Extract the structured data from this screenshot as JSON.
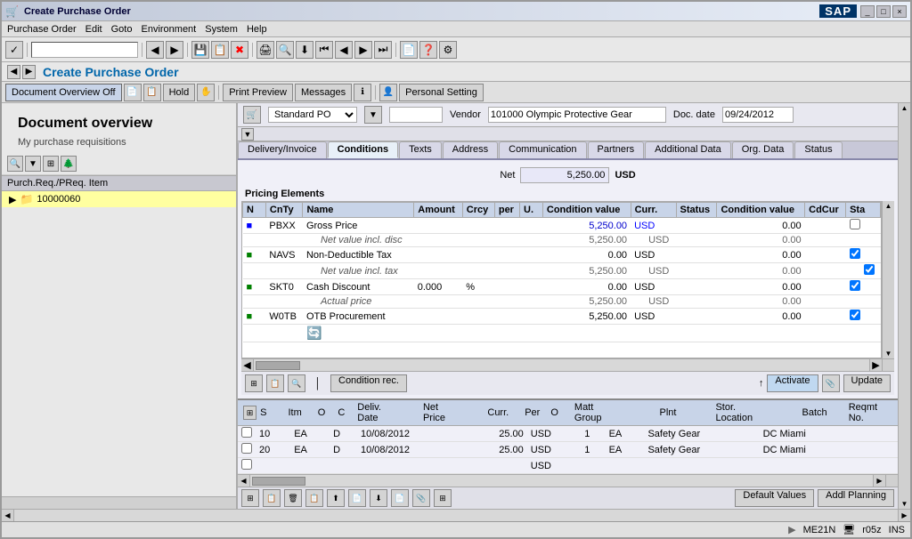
{
  "window": {
    "title": "Create Purchase Order",
    "controls": [
      "_",
      "□",
      "×"
    ]
  },
  "menu": {
    "items": [
      "Purchase Order",
      "Edit",
      "Goto",
      "Environment",
      "System",
      "Help"
    ]
  },
  "header": {
    "title": "Create Purchase Order",
    "logo": "SAP"
  },
  "action_toolbar": {
    "buttons": [
      {
        "label": "Document Overview Off",
        "active": true
      },
      {
        "label": "Hold"
      },
      {
        "label": "Print Preview"
      },
      {
        "label": "Messages"
      },
      {
        "label": "Personal Setting"
      }
    ]
  },
  "left_panel": {
    "title": "Document overview",
    "subtitle": "My purchase requisitions",
    "toolbar_buttons": [
      "search",
      "filter",
      "grid",
      "tree"
    ],
    "tree_header": "Purch.Req./PReq. Item",
    "tree_items": [
      {
        "id": "10000060",
        "selected": true,
        "type": "folder"
      }
    ]
  },
  "po_header": {
    "doc_type": "Standard PO",
    "vendor_label": "Vendor",
    "vendor_value": "101000 Olympic Protective Gear",
    "doc_date_label": "Doc. date",
    "doc_date_value": "09/24/2012"
  },
  "tabs": {
    "items": [
      "Delivery/Invoice",
      "Conditions",
      "Texts",
      "Address",
      "Communication",
      "Partners",
      "Additional Data",
      "Org. Data",
      "Status"
    ],
    "active": "Conditions"
  },
  "conditions": {
    "net_label": "Net",
    "net_value": "5,250.00",
    "currency": "USD",
    "pricing_header": "Pricing Elements",
    "table": {
      "columns": [
        "N",
        "CnTy",
        "Name",
        "Amount",
        "Crcy",
        "per",
        "U.",
        "Condition value",
        "Curr.",
        "Status",
        "Condition value",
        "CdCur",
        "Sta"
      ],
      "rows": [
        {
          "cnty": "PBXX",
          "name": "Gross Price",
          "amount": "",
          "crcy": "",
          "per": "",
          "u": "",
          "cond_val": "5,250.00",
          "curr": "USD",
          "status": "",
          "cond_val2": "0.00",
          "cdcur": "",
          "sta": "",
          "type": "main",
          "dot": "blue"
        },
        {
          "cnty": "",
          "name": "Net value incl. disc",
          "amount": "",
          "crcy": "",
          "per": "",
          "u": "",
          "cond_val": "5,250.00",
          "curr": "USD",
          "status": "",
          "cond_val2": "0.00",
          "cdcur": "",
          "sta": "",
          "type": "sub"
        },
        {
          "cnty": "NAVS",
          "name": "Non-Deductible Tax",
          "amount": "",
          "crcy": "",
          "per": "",
          "u": "",
          "cond_val": "0.00",
          "curr": "USD",
          "status": "",
          "cond_val2": "0.00",
          "cdcur": "",
          "sta": "✓",
          "type": "main",
          "dot": "green"
        },
        {
          "cnty": "",
          "name": "Net value incl. tax",
          "amount": "",
          "crcy": "",
          "per": "",
          "u": "",
          "cond_val": "5,250.00",
          "curr": "USD",
          "status": "",
          "cond_val2": "0.00",
          "cdcur": "",
          "sta": "✓",
          "type": "sub"
        },
        {
          "cnty": "SKT0",
          "name": "Cash Discount",
          "amount": "0.000",
          "crcy": "%",
          "per": "",
          "u": "",
          "cond_val": "0.00",
          "curr": "USD",
          "status": "",
          "cond_val2": "0.00",
          "cdcur": "",
          "sta": "✓",
          "type": "main",
          "dot": "green"
        },
        {
          "cnty": "",
          "name": "Actual price",
          "amount": "",
          "crcy": "",
          "per": "",
          "u": "",
          "cond_val": "5,250.00",
          "curr": "USD",
          "status": "",
          "cond_val2": "0.00",
          "cdcur": "",
          "sta": "",
          "type": "sub"
        },
        {
          "cnty": "W0TB",
          "name": "OTB Procurement",
          "amount": "",
          "crcy": "",
          "per": "",
          "u": "",
          "cond_val": "5,250.00",
          "curr": "USD",
          "status": "",
          "cond_val2": "0.00",
          "cdcur": "",
          "sta": "✓",
          "type": "main",
          "dot": "green"
        }
      ]
    },
    "toolbar_buttons": {
      "condition_rec": "Condition rec.",
      "activate": "Activate",
      "update": "Update"
    }
  },
  "items": {
    "columns": [
      "S",
      "Itm",
      "O",
      "C",
      "Deliv. Date",
      "Net Price",
      "Curr.",
      "Per",
      "O",
      "Matt Group",
      "Plnt",
      "Stor. Location",
      "Batch",
      "Reqmt No."
    ],
    "rows": [
      {
        "s": "",
        "itm": "10",
        "o": "EA",
        "c": "D",
        "deliv_date": "10/08/2012",
        "net_price": "25.00",
        "curr": "USD",
        "per": "1",
        "o2": "EA",
        "matt_group": "Safety Gear",
        "plnt": "DC Miami",
        "stor": "",
        "batch": "",
        "reqmt": ""
      },
      {
        "s": "",
        "itm": "20",
        "o": "EA",
        "c": "D",
        "deliv_date": "10/08/2012",
        "net_price": "25.00",
        "curr": "USD",
        "per": "1",
        "o2": "EA",
        "matt_group": "Safety Gear",
        "plnt": "DC Miami",
        "stor": "",
        "batch": "",
        "reqmt": ""
      },
      {
        "s": "",
        "itm": "",
        "o": "",
        "c": "",
        "deliv_date": "",
        "net_price": "",
        "curr": "USD",
        "per": "",
        "o2": "",
        "matt_group": "",
        "plnt": "",
        "stor": "",
        "batch": "",
        "reqmt": ""
      }
    ],
    "buttons": [
      "Default Values",
      "Addl Planning"
    ]
  },
  "status_bar": {
    "mode": "ME21N",
    "server": "r05z",
    "ins": "INS"
  }
}
